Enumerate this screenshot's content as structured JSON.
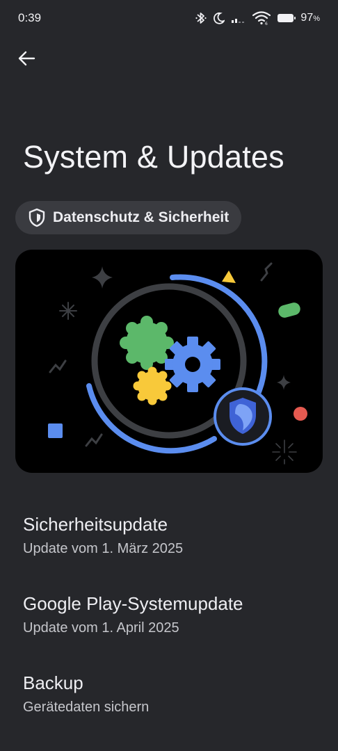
{
  "status_bar": {
    "time": "0:39",
    "battery_percent": "97",
    "battery_suffix": "%",
    "icons": [
      "bluetooth-icon",
      "do-not-disturb-moon-icon",
      "signal-icon",
      "wifi-icon",
      "battery-icon"
    ]
  },
  "header": {
    "back_icon": "arrow-back-icon",
    "title": "System & Updates"
  },
  "chip": {
    "icon": "shield-icon",
    "label": "Datenschutz & Sicherheit"
  },
  "hero": {
    "icon": "gears-shield-illustration",
    "colors": {
      "green": "#5cb86a",
      "yellow": "#f8c93a",
      "blue": "#5b8def",
      "red": "#e55a50",
      "ring": "#3d3f43"
    }
  },
  "items": [
    {
      "title": "Sicherheitsupdate",
      "subtitle": "Update vom 1. März 2025"
    },
    {
      "title": "Google Play-Systemupdate",
      "subtitle": "Update vom 1. April 2025"
    },
    {
      "title": "Backup",
      "subtitle": "Gerätedaten sichern"
    }
  ]
}
